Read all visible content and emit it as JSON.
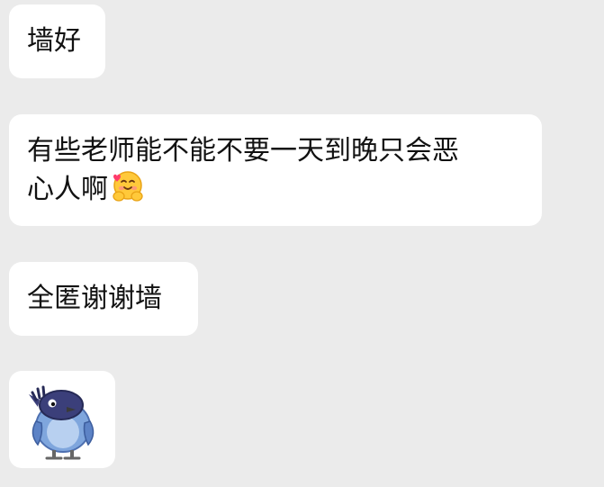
{
  "messages": [
    {
      "text": "墙好"
    },
    {
      "text": "有些老师能不能不要一天到晚只会恶",
      "text_line2": "心人啊",
      "emoji": "hugging-face-emoji"
    },
    {
      "text": "全匿谢谢墙"
    },
    {
      "sticker": "blue-bird-sticker"
    }
  ],
  "colors": {
    "background": "#ebebeb",
    "bubble": "#ffffff",
    "text": "#111111"
  }
}
